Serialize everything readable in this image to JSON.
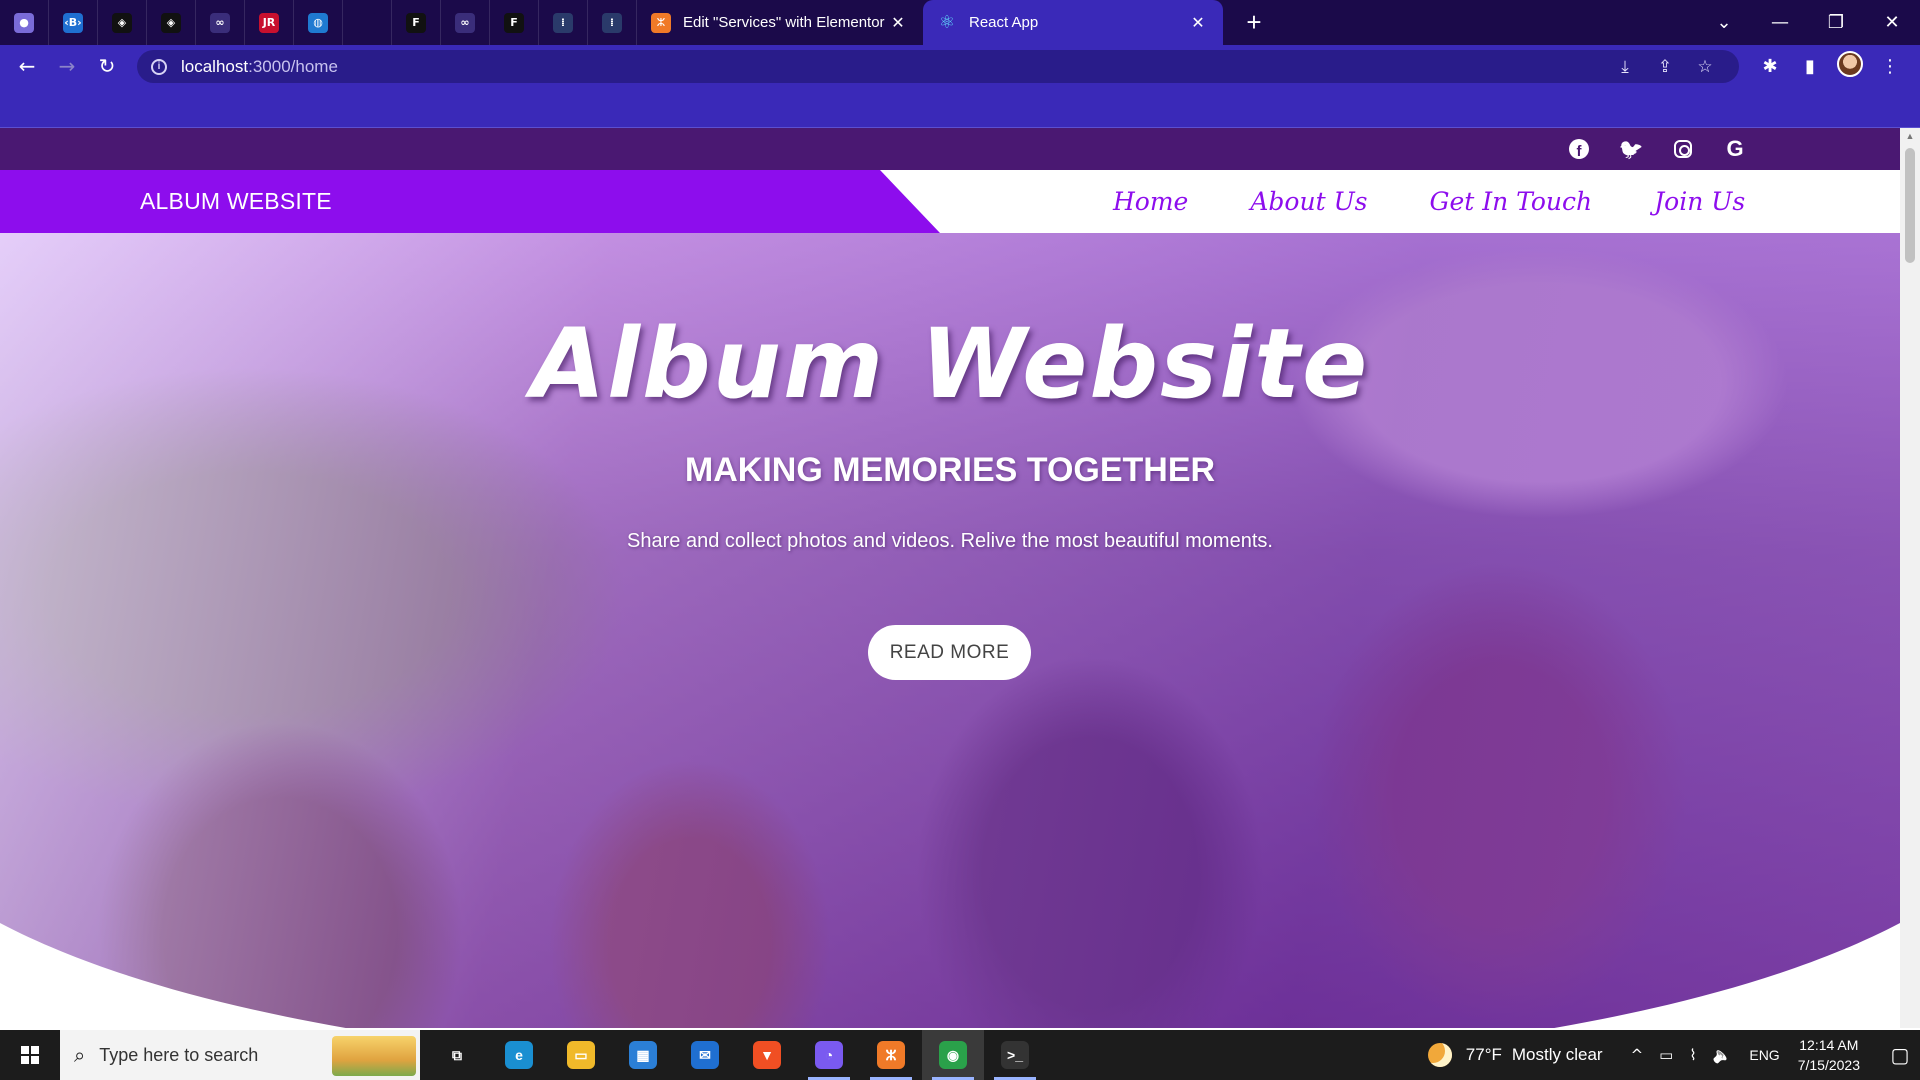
{
  "browser": {
    "pinned_tabs": [
      {
        "icon": "app-icon-1",
        "glyph": "●",
        "color": "#7a6bd8"
      },
      {
        "icon": "bootstrap-icon",
        "glyph": "‹B›",
        "color": "#1f6fd1"
      },
      {
        "icon": "codepen-icon",
        "glyph": "◈",
        "color": "#111111"
      },
      {
        "icon": "codepen-icon",
        "glyph": "◈",
        "color": "#111111"
      },
      {
        "icon": "infinity-icon",
        "glyph": "∞",
        "color": "#3a2d7a"
      },
      {
        "icon": "jr-icon",
        "glyph": "JR",
        "color": "#c8102e"
      },
      {
        "icon": "globe-icon",
        "glyph": "◍",
        "color": "#1f7ad1"
      },
      {
        "icon": "blank-icon",
        "glyph": "",
        "color": "#1b0a4a"
      },
      {
        "icon": "f-icon",
        "glyph": "F",
        "color": "#111111"
      },
      {
        "icon": "infinity-icon",
        "glyph": "∞",
        "color": "#3a2d7a"
      },
      {
        "icon": "f-icon",
        "glyph": "F",
        "color": "#111111"
      },
      {
        "icon": "dots-icon",
        "glyph": "⁞",
        "color": "#2a3a6a"
      },
      {
        "icon": "dots-icon",
        "glyph": "⁞",
        "color": "#2a3a6a"
      }
    ],
    "tabs": [
      {
        "title": "Edit \"Services\" with Elementor",
        "icon": "xampp-icon",
        "icon_color": "#f07a28",
        "active": false
      },
      {
        "title": "React App",
        "icon": "react-icon",
        "icon_color": "#61dafb",
        "active": true
      }
    ],
    "close_glyph": "✕",
    "new_tab_glyph": "+",
    "window_controls": {
      "dropdown": "⌄",
      "minimize": "—",
      "restore": "❐",
      "close": "✕"
    },
    "nav": {
      "back": "←",
      "forward": "→",
      "reload": "↻"
    },
    "address": {
      "host": "localhost",
      "path": ":3000/home"
    },
    "address_actions": [
      "⤓",
      "⇪",
      "☆"
    ],
    "toolbar_actions": [
      "✱",
      "▮"
    ]
  },
  "page": {
    "social_icons": [
      "facebook-icon",
      "twitter-icon",
      "instagram-icon",
      "google-icon"
    ],
    "social_glyphs": {
      "facebook": "f",
      "twitter": "🐦",
      "google": "G"
    },
    "brand": "ALBUM WEBSITE",
    "menu": [
      "Home",
      "About Us",
      "Get In Touch",
      "Join Us"
    ],
    "hero": {
      "title": "Album Website",
      "subtitle": "MAKING MEMORIES TOGETHER",
      "description": "Share and collect photos and videos. Relive the most beautiful moments.",
      "button": "READ MORE"
    },
    "accent_color": "#8d0ded",
    "topbar_color": "#4a1872"
  },
  "taskbar": {
    "search_placeholder": "Type here to search",
    "search_glyph": "⌕",
    "apps": [
      {
        "name": "task-view-icon",
        "glyph": "⧉",
        "color": "#1c1c1c"
      },
      {
        "name": "edge-icon",
        "glyph": "e",
        "color": "#1a8fd1"
      },
      {
        "name": "file-explorer-icon",
        "glyph": "▭",
        "color": "#f0b92a"
      },
      {
        "name": "store-icon",
        "glyph": "▦",
        "color": "#2b7fd6"
      },
      {
        "name": "mail-icon",
        "glyph": "✉",
        "color": "#1f6fd1"
      },
      {
        "name": "brave-icon",
        "glyph": "▼",
        "color": "#f04f23"
      },
      {
        "name": "chat-icon",
        "glyph": "◔",
        "color": "#7a5af0"
      },
      {
        "name": "xampp-icon",
        "glyph": "ⵣ",
        "color": "#f07a28"
      },
      {
        "name": "chrome-icon",
        "glyph": "◉",
        "color": "#2aa14a"
      },
      {
        "name": "terminal-icon",
        "glyph": ">_",
        "color": "#333333"
      }
    ],
    "weather": {
      "temp": "77°F",
      "condition": "Mostly clear"
    },
    "tray_glyphs": [
      "^",
      "▭",
      "⌇",
      "🔈"
    ],
    "language": "ENG",
    "time": "12:14 AM",
    "date": "7/15/2023",
    "notification_glyph": "▢"
  }
}
